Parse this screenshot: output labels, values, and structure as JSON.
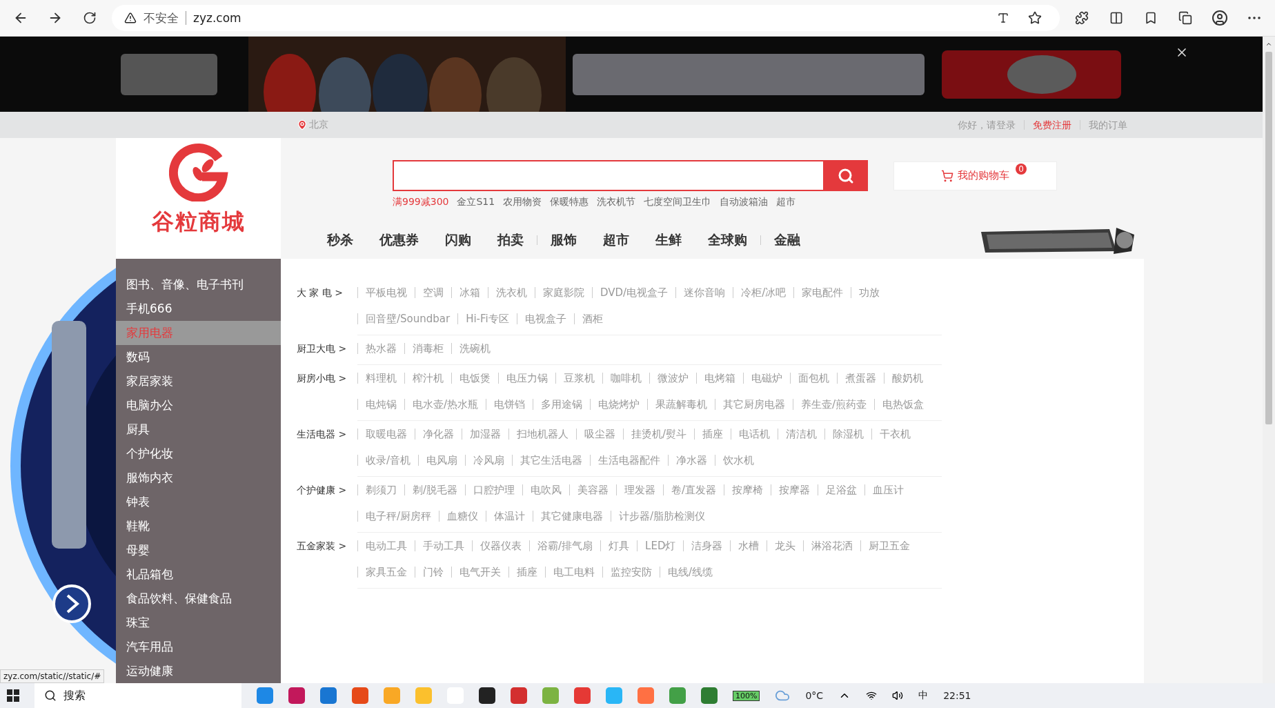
{
  "browser": {
    "security": "不安全",
    "url": "zyz.com"
  },
  "topbar": {
    "location": "北京",
    "links": [
      {
        "label": "你好，请登录",
        "highlight": false
      },
      {
        "label": "免费注册",
        "highlight": true
      },
      {
        "label": "我的订单",
        "highlight": false
      }
    ]
  },
  "logo": {
    "name": "谷粒商城"
  },
  "hot_words": [
    {
      "label": "满999减300",
      "highlight": true
    },
    {
      "label": "金立S11",
      "highlight": false
    },
    {
      "label": "农用物资",
      "highlight": false
    },
    {
      "label": "保暖特惠",
      "highlight": false
    },
    {
      "label": "洗衣机节",
      "highlight": false
    },
    {
      "label": "七度空间卫生巾",
      "highlight": false
    },
    {
      "label": "自动波箱油",
      "highlight": false
    },
    {
      "label": "超市",
      "highlight": false
    }
  ],
  "cart": {
    "label": "我的购物车",
    "count": "0"
  },
  "nav": [
    {
      "label": "秒杀",
      "divider_before": false
    },
    {
      "label": "优惠券",
      "divider_before": false
    },
    {
      "label": "闪购",
      "divider_before": false
    },
    {
      "label": "拍卖",
      "divider_before": false
    },
    {
      "label": "服饰",
      "divider_before": true
    },
    {
      "label": "超市",
      "divider_before": false
    },
    {
      "label": "生鲜",
      "divider_before": false
    },
    {
      "label": "全球购",
      "divider_before": false
    },
    {
      "label": "金融",
      "divider_before": true
    }
  ],
  "categories": [
    {
      "label": "图书、音像、电子书刊",
      "selected": false
    },
    {
      "label": "手机666",
      "selected": false
    },
    {
      "label": "家用电器",
      "selected": true
    },
    {
      "label": "数码",
      "selected": false
    },
    {
      "label": "家居家装",
      "selected": false
    },
    {
      "label": "电脑办公",
      "selected": false
    },
    {
      "label": "厨具",
      "selected": false
    },
    {
      "label": "个护化妆",
      "selected": false
    },
    {
      "label": "服饰内衣",
      "selected": false
    },
    {
      "label": "钟表",
      "selected": false
    },
    {
      "label": "鞋靴",
      "selected": false
    },
    {
      "label": "母婴",
      "selected": false
    },
    {
      "label": "礼品箱包",
      "selected": false
    },
    {
      "label": "食品饮料、保健食品",
      "selected": false
    },
    {
      "label": "珠宝",
      "selected": false
    },
    {
      "label": "汽车用品",
      "selected": false
    },
    {
      "label": "运动健康",
      "selected": false
    }
  ],
  "submenu": [
    {
      "label": "大 家 电 >",
      "items": [
        "平板电视",
        "空调",
        "冰箱",
        "洗衣机",
        "家庭影院",
        "DVD/电视盒子",
        "迷你音响",
        "冷柜/冰吧",
        "家电配件",
        "功放",
        "回音壁/Soundbar",
        "Hi-Fi专区",
        "电视盒子",
        "酒柜"
      ]
    },
    {
      "label": "厨卫大电 >",
      "items": [
        "热水器",
        "消毒柜",
        "洗碗机"
      ]
    },
    {
      "label": "厨房小电 >",
      "items": [
        "料理机",
        "榨汁机",
        "电饭煲",
        "电压力锅",
        "豆浆机",
        "咖啡机",
        "微波炉",
        "电烤箱",
        "电磁炉",
        "面包机",
        "煮蛋器",
        "酸奶机",
        "电炖锅",
        "电水壶/热水瓶",
        "电饼铛",
        "多用途锅",
        "电烧烤炉",
        "果蔬解毒机",
        "其它厨房电器",
        "养生壶/煎药壶",
        "电热饭盒"
      ]
    },
    {
      "label": "生活电器 >",
      "items": [
        "取暖电器",
        "净化器",
        "加湿器",
        "扫地机器人",
        "吸尘器",
        "挂烫机/熨斗",
        "插座",
        "电话机",
        "清洁机",
        "除湿机",
        "干衣机",
        "收录/音机",
        "电风扇",
        "冷风扇",
        "其它生活电器",
        "生活电器配件",
        "净水器",
        "饮水机"
      ]
    },
    {
      "label": "个护健康 >",
      "items": [
        "剃须刀",
        "剃/脱毛器",
        "口腔护理",
        "电吹风",
        "美容器",
        "理发器",
        "卷/直发器",
        "按摩椅",
        "按摩器",
        "足浴盆",
        "血压计",
        "电子秤/厨房秤",
        "血糖仪",
        "体温计",
        "其它健康电器",
        "计步器/脂肪检测仪"
      ]
    },
    {
      "label": "五金家装 >",
      "items": [
        "电动工具",
        "手动工具",
        "仪器仪表",
        "浴霸/排气扇",
        "灯具",
        "LED灯",
        "洁身器",
        "水槽",
        "龙头",
        "淋浴花洒",
        "厨卫五金",
        "家具五金",
        "门铃",
        "电气开关",
        "插座",
        "电工电料",
        "监控安防",
        "电线/线缆"
      ]
    }
  ],
  "status_url": "zyz.com/static//static/#",
  "taskbar": {
    "search": "搜索",
    "battery": "100%",
    "weather": "0°C",
    "ime": "中",
    "time": "22:51"
  }
}
